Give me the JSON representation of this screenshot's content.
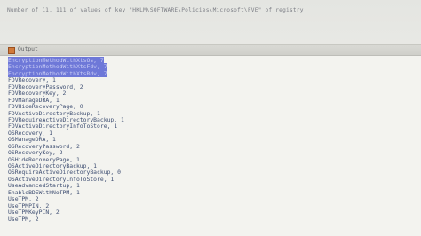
{
  "header": {
    "text": "Number of 11, 111 of values of key \"HKLM\\SOFTWARE\\Policies\\Microsoft\\FVE\" of registry"
  },
  "output": {
    "tab_label": "Output",
    "lines": [
      "EncryptionMethodWithXtsOs, 7",
      "EncryptionMethodWithXtsFdv, 7",
      "EncryptionMethodWithXtsRdv, 7",
      "FDVRecovery, 1",
      "FDVRecoveryPassword, 2",
      "FDVRecoveryKey, 2",
      "FDVManageDRA, 1",
      "FDVHideRecoveryPage, 0",
      "FDVActiveDirectoryBackup, 1",
      "FDVRequireActiveDirectoryBackup, 1",
      "FDVActiveDirectoryInfoToStore, 1",
      "OSRecovery, 1",
      "OSManageDRA, 1",
      "OSRecoveryPassword, 2",
      "OSRecoveryKey, 2",
      "OSHideRecoveryPage, 1",
      "OSActiveDirectoryBackup, 1",
      "OSRequireActiveDirectoryBackup, 0",
      "OSActiveDirectoryInfoToStore, 1",
      "UseAdvancedStartup, 1",
      "EnableBDEWithNoTPM, 1",
      "UseTPM, 2",
      "UseTPMPIN, 2",
      "UseTPMKeyPIN, 2",
      "UseTPM, 2"
    ],
    "selected_count": 3
  },
  "colors": {
    "selection": "#6e78d8",
    "text": "#3e4e72",
    "background": "#f3f3ef"
  }
}
